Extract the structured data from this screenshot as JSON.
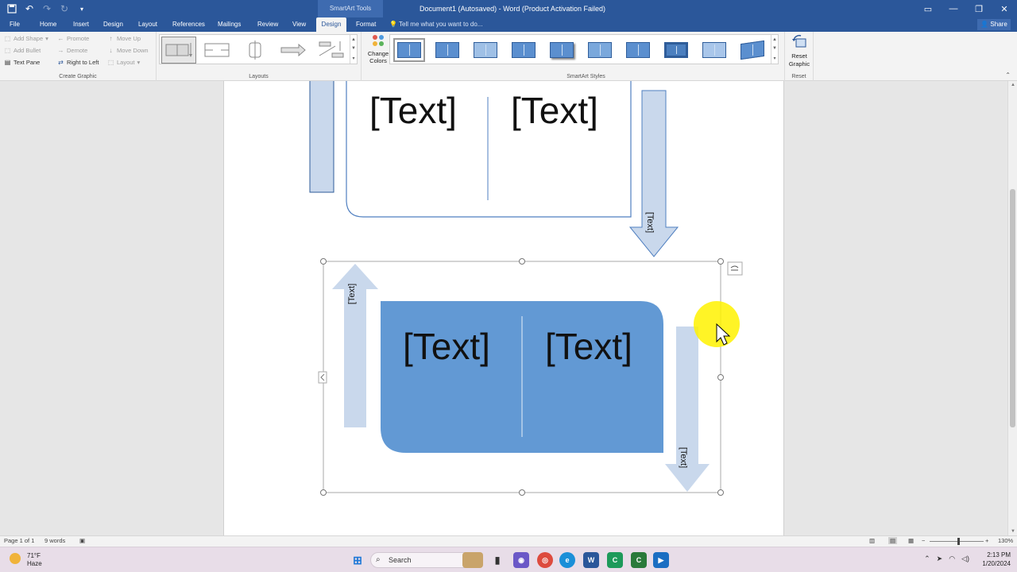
{
  "titlebar": {
    "context_tools": "SmartArt Tools",
    "document_title": "Document1 (Autosaved) - Word (Product Activation Failed)"
  },
  "tabs": [
    "File",
    "Home",
    "Insert",
    "Design",
    "Layout",
    "References",
    "Mailings",
    "Review",
    "View",
    "Design",
    "Format"
  ],
  "active_tab": "Design",
  "tell_me": "Tell me what you want to do...",
  "share": "Share",
  "ribbon": {
    "create_graphic": {
      "label": "Create Graphic",
      "add_shape": "Add Shape",
      "add_bullet": "Add Bullet",
      "text_pane": "Text Pane",
      "promote": "Promote",
      "demote": "Demote",
      "right_to_left": "Right to Left",
      "move_up": "Move Up",
      "move_down": "Move Down",
      "layout": "Layout"
    },
    "layouts_label": "Layouts",
    "change_colors": [
      "Change",
      "Colors"
    ],
    "smartart_styles_label": "SmartArt Styles",
    "reset": {
      "label": "Reset",
      "button": [
        "Reset",
        "Graphic"
      ]
    }
  },
  "smartart": {
    "top_cells": [
      "[Text]",
      "[Text]"
    ],
    "top_arrow_text": "[Text]",
    "bottom_cells": [
      "[Text]",
      "[Text]"
    ],
    "left_arrow_text": "[Text]",
    "right_arrow_text": "[Text]"
  },
  "statusbar": {
    "page": "Page 1 of 1",
    "words": "9 words",
    "zoom": "130%"
  },
  "taskbar": {
    "temperature": "71°F",
    "weather": "Haze",
    "search": "Search",
    "time": "2:13 PM",
    "date": "1/20/2024"
  },
  "colors": {
    "word_blue": "#2b579a",
    "smartart_fill": "#6299d4",
    "arrow_fill": "#c9d8ec",
    "cursor_highlight": "#fff200"
  }
}
